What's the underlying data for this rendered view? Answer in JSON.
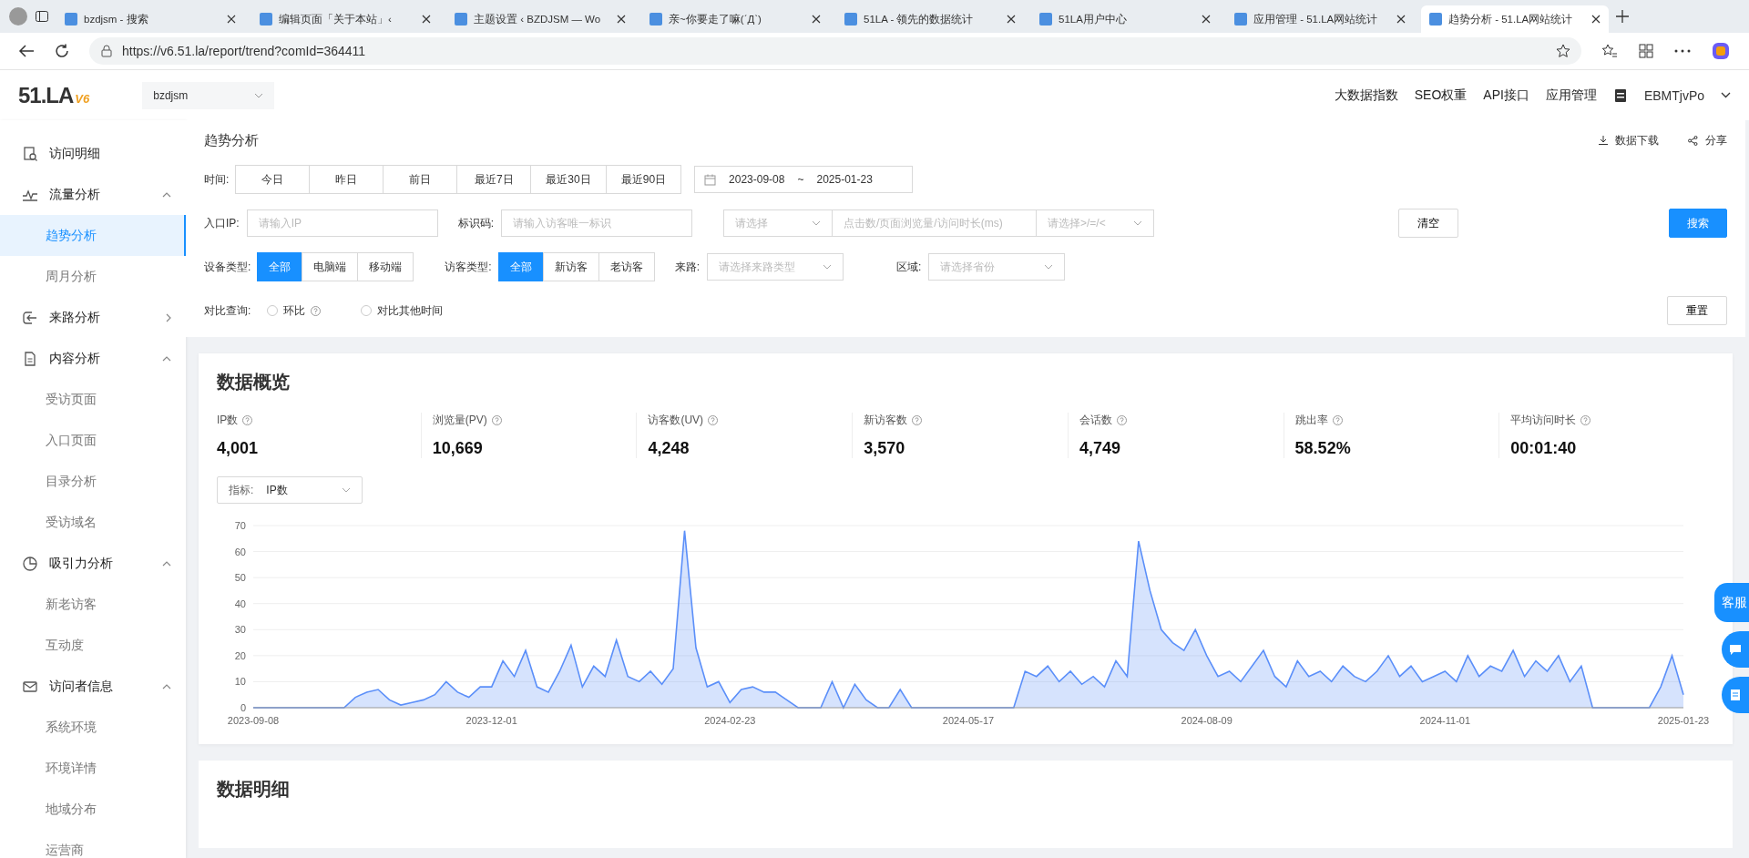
{
  "browser": {
    "tabs": [
      {
        "label": "bzdjsm - 搜索",
        "selected": false
      },
      {
        "label": "编辑页面「关于本站」‹",
        "selected": false
      },
      {
        "label": "主题设置 ‹ BZDJSM — Wo",
        "selected": false
      },
      {
        "label": "亲~你要走了嘛(ˊДˋ)",
        "selected": false
      },
      {
        "label": "51LA - 领先的数据统计",
        "selected": false
      },
      {
        "label": "51LA用户中心",
        "selected": false
      },
      {
        "label": "应用管理 - 51.LA网站统计",
        "selected": false
      },
      {
        "label": "趋势分析 - 51.LA网站统计",
        "selected": true
      }
    ],
    "url": "https://v6.51.la/report/trend?comId=364411"
  },
  "header": {
    "logo": "51.LA",
    "logo_version": "V6",
    "site": "bzdjsm",
    "nav": [
      "大数据指数",
      "SEO权重",
      "API接口",
      "应用管理"
    ],
    "user": "EBMTjvPo"
  },
  "sidebar": {
    "items": [
      {
        "label": "访问明细"
      },
      {
        "label": "流量分析",
        "expanded": true,
        "children": [
          {
            "label": "趋势分析",
            "selected": true
          },
          {
            "label": "周月分析",
            "selected": false
          }
        ]
      },
      {
        "label": "来路分析",
        "expanded": false
      },
      {
        "label": "内容分析",
        "expanded": true,
        "children": [
          {
            "label": "受访页面",
            "selected": false
          },
          {
            "label": "入口页面",
            "selected": false
          },
          {
            "label": "目录分析",
            "selected": false
          },
          {
            "label": "受访域名",
            "selected": false
          }
        ]
      },
      {
        "label": "吸引力分析",
        "expanded": true,
        "children": [
          {
            "label": "新老访客",
            "selected": false
          },
          {
            "label": "互动度",
            "selected": false
          }
        ]
      },
      {
        "label": "访问者信息",
        "expanded": true,
        "children": [
          {
            "label": "系统环境",
            "selected": false
          },
          {
            "label": "环境详情",
            "selected": false
          },
          {
            "label": "地域分布",
            "selected": false
          },
          {
            "label": "运营商",
            "selected": false
          }
        ]
      }
    ]
  },
  "filters": {
    "title": "趋势分析",
    "download": "数据下载",
    "share": "分享",
    "time_label": "时间:",
    "time_buttons": [
      "今日",
      "昨日",
      "前日",
      "最近7日",
      "最近30日",
      "最近90日"
    ],
    "date_start": "2023-09-08",
    "date_sep": "~",
    "date_end": "2025-01-23",
    "ip_label": "入口IP:",
    "ip_placeholder": "请输入IP",
    "code_label": "标识码:",
    "code_placeholder": "请输入访客唯一标识",
    "metric_placeholder": "请选择",
    "value_placeholder": "点击数/页面浏览量/访问时长(ms)",
    "op_placeholder": "请选择>/=/<",
    "clear": "清空",
    "search": "搜索",
    "device_label": "设备类型:",
    "device_options": [
      {
        "label": "全部",
        "selected": true
      },
      {
        "label": "电脑端",
        "selected": false
      },
      {
        "label": "移动端",
        "selected": false
      }
    ],
    "visitor_label": "访客类型:",
    "visitor_options": [
      {
        "label": "全部",
        "selected": true
      },
      {
        "label": "新访客",
        "selected": false
      },
      {
        "label": "老访客",
        "selected": false
      }
    ],
    "source_label": "来路:",
    "source_placeholder": "请选择来路类型",
    "region_label": "区域:",
    "region_placeholder": "请选择省份",
    "compare_label": "对比查询:",
    "compare_options": [
      {
        "label": "环比",
        "selected": false,
        "help": true
      },
      {
        "label": "对比其他时间",
        "selected": false,
        "help": false
      }
    ],
    "reset": "重置"
  },
  "overview": {
    "title": "数据概览",
    "stats": [
      {
        "label": "IP数",
        "value": "4,001"
      },
      {
        "label": "浏览量(PV)",
        "value": "10,669"
      },
      {
        "label": "访客数(UV)",
        "value": "4,248"
      },
      {
        "label": "新访客数",
        "value": "3,570"
      },
      {
        "label": "会话数",
        "value": "4,749"
      },
      {
        "label": "跳出率",
        "value": "58.52%"
      },
      {
        "label": "平均访问时长",
        "value": "00:01:40"
      }
    ],
    "metric_label": "指标:",
    "metric_value": "IP数",
    "chart_data": {
      "type": "area",
      "grid": true,
      "ylim": [
        0,
        70
      ],
      "yticks": [
        0,
        10,
        20,
        30,
        40,
        50,
        60,
        70
      ],
      "categories": [
        "2023-09-08",
        null,
        null,
        null,
        null,
        null,
        null,
        null,
        null,
        null,
        null,
        null,
        null,
        null,
        null,
        null,
        null,
        null,
        null,
        null,
        null,
        "2023-12-01",
        null,
        null,
        null,
        null,
        null,
        null,
        null,
        null,
        null,
        null,
        null,
        null,
        null,
        null,
        null,
        null,
        null,
        null,
        null,
        null,
        "2024-02-23",
        null,
        null,
        null,
        null,
        null,
        null,
        null,
        null,
        null,
        null,
        null,
        null,
        null,
        null,
        null,
        null,
        null,
        null,
        null,
        null,
        "2024-05-17",
        null,
        null,
        null,
        null,
        null,
        null,
        null,
        null,
        null,
        null,
        null,
        null,
        null,
        null,
        null,
        null,
        null,
        null,
        null,
        null,
        "2024-08-09",
        null,
        null,
        null,
        null,
        null,
        null,
        null,
        null,
        null,
        null,
        null,
        null,
        null,
        null,
        null,
        null,
        null,
        null,
        null,
        null,
        "2024-11-01",
        null,
        null,
        null,
        null,
        null,
        null,
        null,
        null,
        null,
        null,
        null,
        null,
        null,
        null,
        null,
        null,
        null,
        null,
        null,
        null,
        "2025-01-23"
      ],
      "series": [
        {
          "color": "#5b8ff9",
          "values": [
            0,
            0,
            0,
            0,
            0,
            0,
            0,
            0,
            0,
            4,
            6,
            7,
            3,
            1,
            2,
            3,
            5,
            10,
            6,
            4,
            8,
            8,
            18,
            12,
            22,
            8,
            6,
            14,
            24,
            8,
            16,
            12,
            26,
            12,
            10,
            14,
            9,
            15,
            68,
            23,
            8,
            10,
            2,
            7,
            8,
            6,
            6,
            3,
            0,
            0,
            0,
            10,
            0,
            9,
            3,
            0,
            0,
            7,
            0,
            0,
            0,
            0,
            0,
            0,
            0,
            0,
            0,
            0,
            14,
            12,
            16,
            10,
            14,
            9,
            12,
            8,
            18,
            12,
            64,
            45,
            30,
            25,
            22,
            30,
            20,
            12,
            14,
            10,
            16,
            22,
            12,
            8,
            18,
            12,
            14,
            10,
            16,
            12,
            10,
            14,
            20,
            12,
            16,
            10,
            12,
            14,
            10,
            20,
            12,
            16,
            14,
            22,
            12,
            18,
            14,
            20,
            10,
            16,
            0,
            0,
            0,
            0,
            0,
            0,
            8,
            20,
            5
          ]
        }
      ]
    }
  },
  "detail": {
    "title": "数据明细"
  },
  "float": {
    "service": "客服"
  }
}
